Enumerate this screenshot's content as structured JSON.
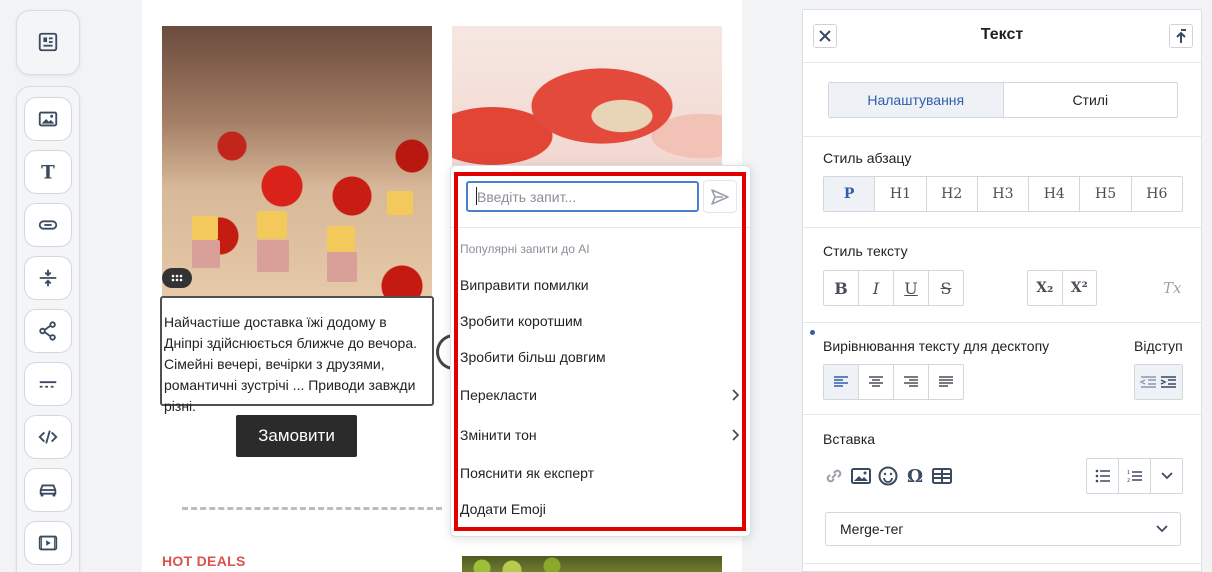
{
  "toolbar": {
    "items": [
      {
        "icon": "layout-icon"
      },
      {
        "icon": "image-icon"
      },
      {
        "icon": "text-icon"
      },
      {
        "icon": "button-icon"
      },
      {
        "icon": "spacer-icon"
      },
      {
        "icon": "share-icon"
      },
      {
        "icon": "divider-icon"
      },
      {
        "icon": "code-icon"
      },
      {
        "icon": "car-icon"
      },
      {
        "icon": "video-icon"
      }
    ]
  },
  "canvas": {
    "body_text": "Найчастіше доставка їжі додому в Дніпрі здійснюється ближче до вечора. Сімейні вечері, вечірки з друзями, романтичні зустрічі ... Приводи завжди різні.",
    "order_button": "Замовити",
    "hot_deals": "HOT DEALS"
  },
  "ai_popup": {
    "input_placeholder": "Введіть запит...",
    "section_title": "Популярні запити до AI",
    "items": [
      {
        "label": "Виправити помилки",
        "has_submenu": false
      },
      {
        "label": "Зробити коротшим",
        "has_submenu": false
      },
      {
        "label": "Зробити більш довгим",
        "has_submenu": false
      },
      {
        "label": "Перекласти",
        "has_submenu": true
      },
      {
        "label": "Змінити тон",
        "has_submenu": true
      },
      {
        "label": "Пояснити як експерт",
        "has_submenu": false
      },
      {
        "label": "Додати Emoji",
        "has_submenu": false
      }
    ],
    "highlight_color": "#e00000"
  },
  "panel": {
    "title": "Текст",
    "tabs": [
      "Налаштування",
      "Стилі"
    ],
    "active_tab": 0,
    "paragraph_style": {
      "label": "Стиль абзацу",
      "options": [
        "P",
        "H1",
        "H2",
        "H3",
        "H4",
        "H5",
        "H6"
      ],
      "active": "P"
    },
    "text_style": {
      "label": "Стиль тексту",
      "buttons": [
        "B",
        "I",
        "U",
        "S"
      ],
      "script_buttons": [
        "X₂",
        "X²"
      ],
      "clear": "Tx"
    },
    "alignment": {
      "label": "Вирівнювання тексту для десктопу",
      "indent_label": "Відступ",
      "options": [
        "align-left",
        "align-center",
        "align-right",
        "align-justify"
      ],
      "active": "align-left"
    },
    "insert": {
      "label": "Вставка",
      "icons": [
        "link-icon",
        "image-icon",
        "emoji-icon",
        "omega-icon",
        "table-icon"
      ]
    },
    "merge_tag": "Merge-тег"
  },
  "colors": {
    "accent": "#2e5ea8",
    "hot_deals": "#d9534f",
    "button_bg": "#2b2b2b"
  }
}
